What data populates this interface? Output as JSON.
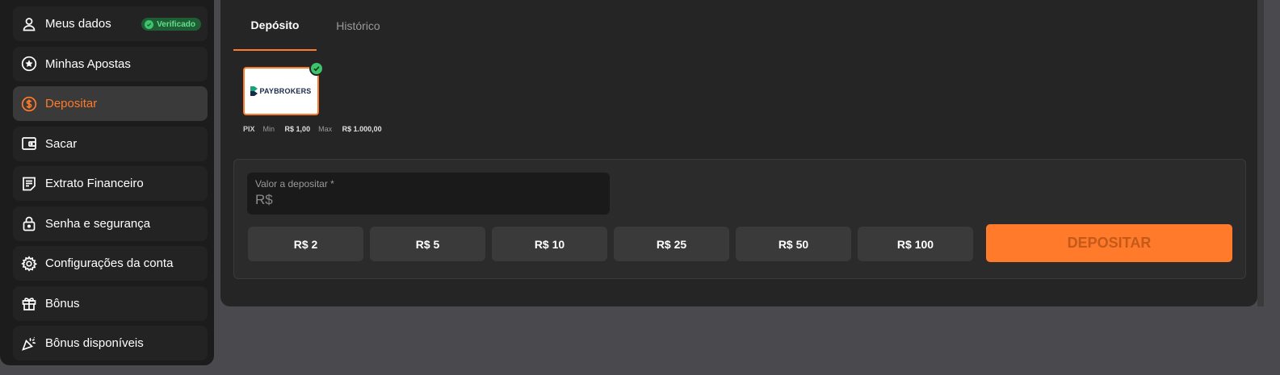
{
  "sidebar": {
    "items": [
      {
        "label": "Meus dados",
        "icon": "user-icon",
        "badge": "Verificado"
      },
      {
        "label": "Minhas Apostas",
        "icon": "star-icon"
      },
      {
        "label": "Depositar",
        "icon": "dollar-icon"
      },
      {
        "label": "Sacar",
        "icon": "wallet-icon"
      },
      {
        "label": "Extrato Financeiro",
        "icon": "statement-icon"
      },
      {
        "label": "Senha e segurança",
        "icon": "lock-icon"
      },
      {
        "label": "Configurações da conta",
        "icon": "gear-icon"
      },
      {
        "label": "Bônus",
        "icon": "gift-icon"
      },
      {
        "label": "Bônus disponíveis",
        "icon": "party-icon"
      }
    ],
    "active_index": 2
  },
  "tabs": [
    {
      "label": "Depósito",
      "active": true
    },
    {
      "label": "Histórico",
      "active": false
    }
  ],
  "payment_method": {
    "logo_text": "PAYBROKERS",
    "type": "PIX",
    "min_label": "Min",
    "min_value": "R$ 1,00",
    "max_label": "Max",
    "max_value": "R$ 1.000,00"
  },
  "deposit_form": {
    "amount_label": "Valor a depositar *",
    "amount_placeholder": "R$",
    "quick_amounts": [
      "R$ 2",
      "R$ 5",
      "R$ 10",
      "R$ 25",
      "R$ 50",
      "R$ 100"
    ],
    "submit_label": "DEPOSITAR"
  },
  "colors": {
    "accent": "#ff7a2a",
    "success": "#3ec46d",
    "panel": "#252525",
    "sidebar": "#1c1c1c"
  }
}
